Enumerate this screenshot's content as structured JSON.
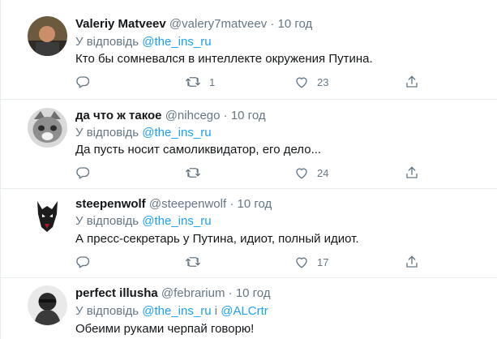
{
  "tweets": [
    {
      "name": "Valeriy Matveev",
      "handle": "@valery7matveev",
      "dot": "·",
      "time": "10 год",
      "reply_prefix": "У відповідь",
      "reply_to": [
        "@the_ins_ru"
      ],
      "text": "Кто бы сомневался в интеллекте окружения Путина.",
      "counts": {
        "reply": "",
        "retweet": "1",
        "like": "23"
      }
    },
    {
      "name": "да что ж такое",
      "handle": "@nihcego",
      "dot": "·",
      "time": "10 год",
      "reply_prefix": "У відповідь",
      "reply_to": [
        "@the_ins_ru"
      ],
      "text": "Да пусть носит самоликвидатор, его дело...",
      "counts": {
        "reply": "",
        "retweet": "",
        "like": "24"
      }
    },
    {
      "name": "steepenwolf",
      "handle": "@steepenwolf",
      "dot": "·",
      "time": "10 год",
      "reply_prefix": "У відповідь",
      "reply_to": [
        "@the_ins_ru"
      ],
      "text": "А пресс-секретарь у Путина, идиот, полный идиот.",
      "counts": {
        "reply": "",
        "retweet": "",
        "like": "17"
      }
    },
    {
      "name": "perfect illusha",
      "handle": "@febrarium",
      "dot": "·",
      "time": "10 год",
      "reply_prefix": "У відповідь",
      "reply_to": [
        "@the_ins_ru",
        "@ALCrtr"
      ],
      "reply_joiner": "і",
      "text": "Обеими руками черпай говорю!"
    }
  ],
  "colors": {
    "link": "#1da1f2",
    "muted": "#657786",
    "text": "#14171a",
    "border": "#e6ecf0"
  },
  "icons": [
    "reply-icon",
    "retweet-icon",
    "like-icon",
    "share-icon"
  ]
}
